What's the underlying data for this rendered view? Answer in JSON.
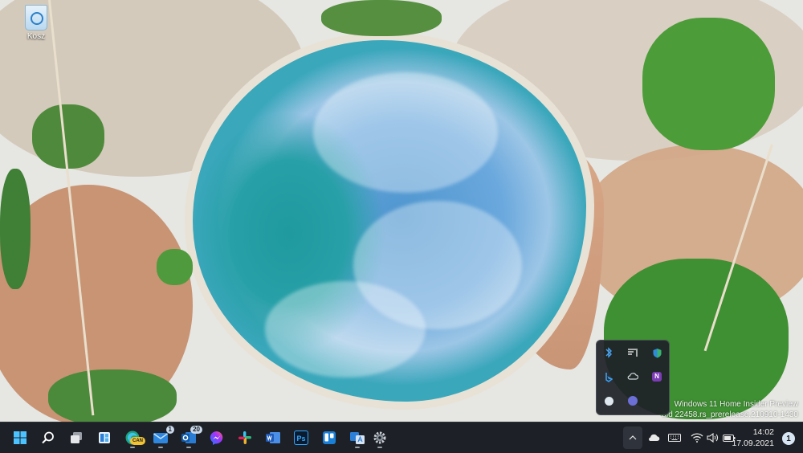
{
  "desktop": {
    "icons": [
      {
        "label": "Kosz",
        "icon": "recycle-bin-icon"
      }
    ],
    "watermark": {
      "line1": "Windows 11 Home Insider Preview",
      "line2": "ald 22458.rs_prerelease.210910-1430"
    }
  },
  "tray_flyout": {
    "icons": [
      "bluetooth-icon",
      "cast-icon",
      "defender-icon",
      "bing-icon",
      "onedrive-icon",
      "onenote-icon",
      "chat-icon",
      "teams-icon"
    ]
  },
  "taskbar": {
    "apps": [
      {
        "name": "start-icon"
      },
      {
        "name": "search-icon"
      },
      {
        "name": "task-view-icon"
      },
      {
        "name": "widgets-icon"
      },
      {
        "name": "edge-canary-icon",
        "badge": "CAN"
      },
      {
        "name": "mail-icon",
        "badge": "1"
      },
      {
        "name": "outlook-icon",
        "badge": "20"
      },
      {
        "name": "messenger-icon"
      },
      {
        "name": "slack-icon"
      },
      {
        "name": "word-icon"
      },
      {
        "name": "photoshop-icon",
        "label": "Ps"
      },
      {
        "name": "trello-icon"
      },
      {
        "name": "translator-icon"
      },
      {
        "name": "settings-icon"
      }
    ],
    "tray": {
      "chevron": "chevron-up-icon",
      "icons": [
        "onedrive-cloud-icon",
        "keyboard-icon",
        "wifi-icon",
        "volume-icon",
        "battery-icon"
      ]
    },
    "clock": {
      "time": "14:02",
      "date": "17.09.2021"
    },
    "notifications": {
      "count": "1"
    }
  }
}
